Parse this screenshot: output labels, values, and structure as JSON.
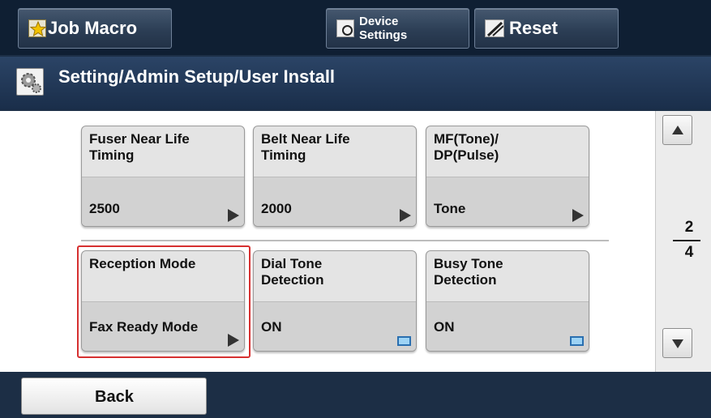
{
  "toolbar": {
    "job_macro_label": "Job Macro",
    "device_settings_line1": "Device",
    "device_settings_line2": "Settings",
    "reset_label": "Reset"
  },
  "title": "Setting/Admin Setup/User Install",
  "tiles": [
    {
      "label_line1": "Fuser Near Life",
      "label_line2": "Timing",
      "value": "2500",
      "indicator": "arrow"
    },
    {
      "label_line1": "Belt Near Life",
      "label_line2": "Timing",
      "value": "2000",
      "indicator": "arrow"
    },
    {
      "label_line1": "MF(Tone)/",
      "label_line2": "DP(Pulse)",
      "value": "Tone",
      "indicator": "arrow"
    },
    {
      "label_line1": "Reception Mode",
      "label_line2": "",
      "value": "Fax Ready Mode",
      "indicator": "arrow",
      "selected": true
    },
    {
      "label_line1": "Dial Tone",
      "label_line2": "Detection",
      "value": "ON",
      "indicator": "checkbox"
    },
    {
      "label_line1": "Busy Tone",
      "label_line2": "Detection",
      "value": "ON",
      "indicator": "checkbox"
    }
  ],
  "pager": {
    "current": "2",
    "total": "4"
  },
  "footer": {
    "back_label": "Back"
  },
  "colors": {
    "selection": "#d63030",
    "checkbox": "#2a6fb0"
  }
}
